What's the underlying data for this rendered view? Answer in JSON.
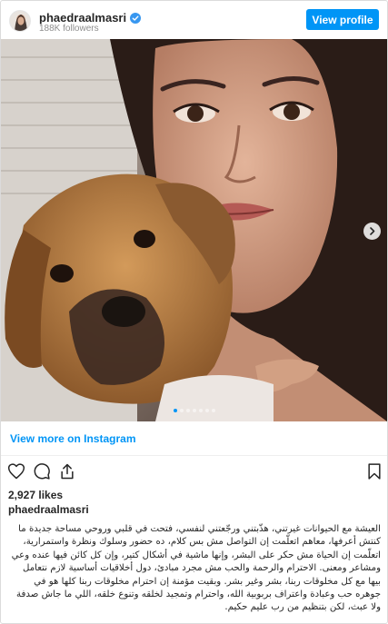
{
  "header": {
    "username": "phaedraalmasri",
    "followers": "188K followers",
    "view_profile_label": "View profile"
  },
  "icons": {
    "verified": "verified-badge-icon",
    "next": "chevron-right-icon",
    "like": "heart-icon",
    "comment": "comment-icon",
    "share": "share-icon",
    "save": "bookmark-icon"
  },
  "carousel": {
    "total": 7,
    "current": 1
  },
  "view_more_label": "View more on Instagram",
  "likes": "2,927 likes",
  "caption": {
    "username": "phaedraalmasri",
    "text": "العيشة مع الحيوانات غيرتني، هذّبتني ورجّعتني لنفسي، فتحت في قلبي وروحي مساحة جديدة ما كنتش أعرفها، معاهم اتعلّمت إن التواصل مش بس كلام، ده حضور وسلوك ونظرة واستمرارية، اتعلّمت إن الحياة مش حكر على البشر، وإنها ماشية في أشكال كتير، وإن كل كائن فيها عنده وعي ومشاعر ومعنى. الاحترام والرحمة والحب مش مجرد مبادئ، دول أخلاقيات أساسية لازم نتعامل بيها مع كل مخلوقات ربنا، بشر وغير بشر. وبقيت مؤمنة إن احترام مخلوقات ربنا كلها هو في جوهره حب وعبادة واعتراف بربوبية الله، واحترام وتمجيد لخلقه وتنوع خلقه، اللي ما جاش صدفة ولا عبث، لكن بتنظيم من رب عليم حكيم."
  },
  "colors": {
    "accent": "#0095f6",
    "text": "#262626",
    "muted": "#8e8e8e",
    "border": "#dbdbdb"
  }
}
